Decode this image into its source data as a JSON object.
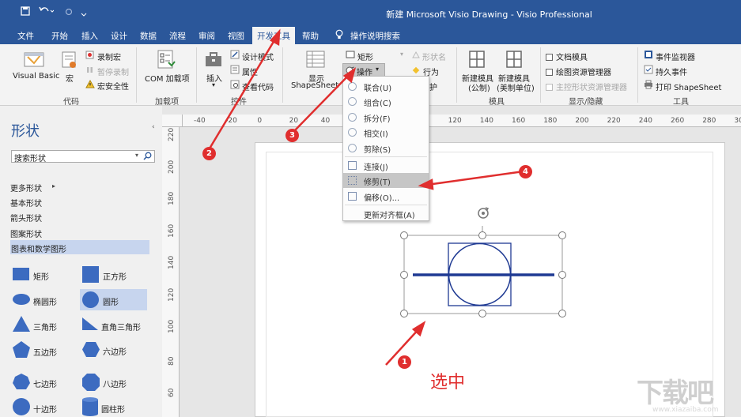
{
  "titlebar": {
    "title": "新建 Microsoft Visio Drawing  -  Visio Professional",
    "save_icon": "save-icon",
    "undo_icon": "undo-icon",
    "redo_icon": "redo-icon"
  },
  "tabs": [
    "文件",
    "开始",
    "插入",
    "设计",
    "数据",
    "流程",
    "审阅",
    "视图",
    "开发工具",
    "帮助",
    "操作说明搜索"
  ],
  "ribbon": {
    "code": {
      "visual_basic": "Visual Basic",
      "macro": "宏",
      "record_macro": "录制宏",
      "pause_recording": "暂停录制",
      "macro_security": "宏安全性",
      "group": "代码"
    },
    "addins": {
      "com": "COM 加载项",
      "group": "加载项"
    },
    "controls": {
      "insert": "插入",
      "design_mode": "设计模式",
      "properties": "属性",
      "view_code": "查看代码",
      "group": "控件"
    },
    "shape_design": {
      "show_shapesheet_1": "显示",
      "show_shapesheet_2": "ShapeSheet",
      "rectangle": "矩形",
      "operation": "操作",
      "shape_name": "形状名",
      "behavior": "行为",
      "protect": "护"
    },
    "stencil": {
      "new_metric_1": "新建模具",
      "new_metric_2": "(公制)",
      "new_us_1": "新建模具",
      "new_us_2": "(美制单位)",
      "group": "模具"
    },
    "show_hide": {
      "doc_stencil": "文档模具",
      "drawing_explorer": "绘图资源管理器",
      "master_explorer": "主控形状资源管理器",
      "group": "显示/隐藏"
    },
    "tools": {
      "event_monitor": "事件监视器",
      "persistent_events": "持久事件",
      "print_shapesheet": "打印 ShapeSheet",
      "group": "工具"
    }
  },
  "dropdown": {
    "items": [
      "联合(U)",
      "组合(C)",
      "拆分(F)",
      "相交(I)",
      "剪除(S)",
      "连接(J)",
      "修剪(T)",
      "偏移(O)...",
      "更新对齐框(A)"
    ],
    "highlighted": "修剪(T)"
  },
  "shapes_panel": {
    "title": "形状",
    "search_placeholder": "搜索形状",
    "more_shapes": "更多形状",
    "stencils": [
      "基本形状",
      "箭头形状",
      "图案形状",
      "图表和数学图形"
    ],
    "selected_stencil": "图表和数学图形",
    "shapes": [
      {
        "left": "矩形",
        "right": "正方形"
      },
      {
        "left": "椭圆形",
        "right": "圆形"
      },
      {
        "left": "三角形",
        "right": "直角三角形"
      },
      {
        "left": "五边形",
        "right": "六边形"
      },
      {
        "left": "七边形",
        "right": "八边形"
      },
      {
        "left": "十边形",
        "right": "圆柱形"
      }
    ]
  },
  "ruler": {
    "top": [
      "-40",
      "-20",
      "0",
      "20",
      "40",
      "60",
      "80",
      "100",
      "120",
      "140",
      "160",
      "180",
      "200",
      "220",
      "240",
      "260",
      "280",
      "300"
    ],
    "left": [
      "220",
      "200",
      "180",
      "160",
      "140",
      "120",
      "100",
      "80",
      "60",
      "40"
    ]
  },
  "annotations": {
    "badges": [
      "1",
      "2",
      "3",
      "4"
    ],
    "selected_label": "选中",
    "watermark": "www.xiazaiba.com",
    "watermark_logo": "下载吧"
  },
  "colors": {
    "accent": "#2b579a",
    "shape_stroke": "#1f3a93",
    "annotation_red": "#e02e2e"
  }
}
